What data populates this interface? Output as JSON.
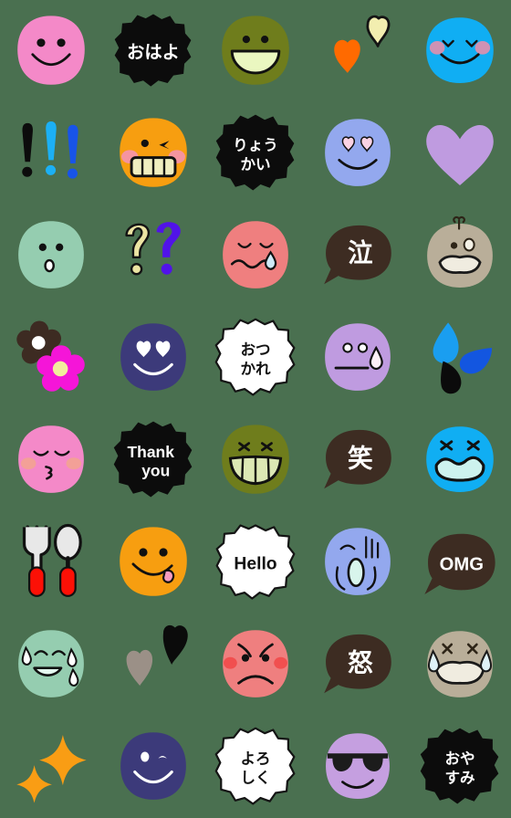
{
  "page": {
    "title": "Emoji Sticker Grid",
    "background_color": "#4a7050",
    "columns": 5,
    "rows": 8,
    "cell_size_px": 112,
    "total_items": 40
  },
  "palette": {
    "background": "#4a7050",
    "pink": "#f489c8",
    "black": "#0c0c0c",
    "olive": "#6f7d1c",
    "orange_heart": "#ff6a00",
    "cream_heart": "#f2eeb0",
    "sky_blue": "#10aef3",
    "mint": "#95cdb0",
    "pale_yellow": "#ece4a3",
    "violet": "#5113e8",
    "salmon": "#ef7f7f",
    "dark_brown": "#3d2c22",
    "taupe": "#b9ae99",
    "flower_brown": "#3d2b22",
    "magenta": "#f515d8",
    "navy": "#3c3a7a",
    "white_cloud": "#ffffff",
    "lavender": "#bf9be0",
    "blue_drop": "#1a9ef0",
    "deep_blue": "#1356e0",
    "orange": "#f79e10",
    "periwinkle": "#93a8ee",
    "red": "#fc1006",
    "silver": "#e3e3e3",
    "amber": "#f99d14",
    "grey_heart": "#9b9087",
    "purple": "#c59fe0",
    "teal_mouth": "#d8f5ec"
  },
  "items": [
    {
      "index": 1,
      "row": 1,
      "col": 1,
      "name": "pink-smiley-face",
      "type": "face",
      "label": "",
      "color": "#f489c8",
      "description": "pink round smiling face with two dots and wide smile"
    },
    {
      "index": 2,
      "row": 1,
      "col": 2,
      "name": "ohayo-text-bubble",
      "type": "text",
      "label": "おはよ",
      "color": "#0c0c0c",
      "text_color": "#ffffff",
      "description": "black fluffy speech blob with Japanese greeting"
    },
    {
      "index": 3,
      "row": 1,
      "col": 3,
      "name": "olive-open-mouth-smile",
      "type": "face",
      "label": "",
      "color": "#6f7d1c",
      "description": "olive green face with big open smile"
    },
    {
      "index": 4,
      "row": 1,
      "col": 4,
      "name": "orange-cream-hearts",
      "type": "object",
      "label": "",
      "color": "#ff6a00",
      "description": "orange heart and cream heart pair"
    },
    {
      "index": 5,
      "row": 1,
      "col": 5,
      "name": "blue-blushing-smile",
      "type": "face",
      "label": "",
      "color": "#10aef3",
      "description": "bright blue face, closed happy eyes, pink cheeks"
    },
    {
      "index": 6,
      "row": 2,
      "col": 1,
      "name": "three-exclamation-marks",
      "type": "object",
      "label": "!!!",
      "color": "#0c0c0c",
      "description": "black, light blue and blue exclamation marks"
    },
    {
      "index": 7,
      "row": 2,
      "col": 2,
      "name": "orange-grin-wink-face",
      "type": "face",
      "label": "",
      "color": "#f79e10",
      "description": "orange face with big teeth grin and wink"
    },
    {
      "index": 8,
      "row": 2,
      "col": 3,
      "name": "ryoukai-text-bubble",
      "type": "text",
      "label": "りょうかい",
      "color": "#0c0c0c",
      "text_color": "#ffffff",
      "lines": [
        "りょう",
        "かい"
      ],
      "description": "black fluffy blob with 'understood'"
    },
    {
      "index": 9,
      "row": 2,
      "col": 4,
      "name": "periwinkle-heart-eyes",
      "type": "face",
      "label": "",
      "color": "#93a8ee",
      "description": "periwinkle face with pink heart eyes and smile"
    },
    {
      "index": 10,
      "row": 2,
      "col": 5,
      "name": "purple-heart",
      "type": "object",
      "label": "",
      "color": "#bf9be0",
      "description": "plain light purple heart"
    },
    {
      "index": 11,
      "row": 3,
      "col": 1,
      "name": "mint-surprised-face",
      "type": "face",
      "label": "",
      "color": "#95cdb0",
      "description": "mint green face with small round open mouth"
    },
    {
      "index": 12,
      "row": 3,
      "col": 2,
      "name": "double-question-marks",
      "type": "object",
      "label": "??",
      "color": "#ece4a3",
      "description": "cream outlined question mark and violet question mark"
    },
    {
      "index": 13,
      "row": 3,
      "col": 3,
      "name": "salmon-crying-face",
      "type": "face",
      "label": "",
      "color": "#ef7f7f",
      "description": "salmon face, closed eyes, wavy mouth, teardrop"
    },
    {
      "index": 14,
      "row": 3,
      "col": 4,
      "name": "naku-text-bubble",
      "type": "text",
      "label": "泣",
      "color": "#3d2c22",
      "text_color": "#ffffff",
      "description": "dark brown speech bubble with kanji for cry"
    },
    {
      "index": 15,
      "row": 3,
      "col": 5,
      "name": "taupe-shocked-face",
      "type": "face",
      "label": "",
      "color": "#b9ae99",
      "description": "taupe face with sweat drop and wide open mouth"
    },
    {
      "index": 16,
      "row": 4,
      "col": 1,
      "name": "two-flowers",
      "type": "object",
      "label": "",
      "color": "#f515d8",
      "description": "dark brown flower and magenta flower"
    },
    {
      "index": 17,
      "row": 4,
      "col": 2,
      "name": "navy-heart-eyes-smile",
      "type": "face",
      "label": "",
      "color": "#3c3a7a",
      "description": "navy face with white heart eyes and smile"
    },
    {
      "index": 18,
      "row": 4,
      "col": 3,
      "name": "otsukare-text-bubble",
      "type": "text",
      "label": "おつかれ",
      "color": "#ffffff",
      "text_color": "#111111",
      "lines": [
        "おつ",
        "かれ"
      ],
      "description": "white cloud blob with 'good work'"
    },
    {
      "index": 19,
      "row": 4,
      "col": 4,
      "name": "lavender-sweat-face",
      "type": "face",
      "label": "",
      "color": "#bf9be0",
      "description": "lavender face, flat mouth, sweat drop"
    },
    {
      "index": 20,
      "row": 4,
      "col": 5,
      "name": "water-droplets",
      "type": "object",
      "label": "",
      "color": "#1a9ef0",
      "description": "three droplets light blue, blue and black"
    },
    {
      "index": 21,
      "row": 5,
      "col": 1,
      "name": "pink-kiss-face",
      "type": "face",
      "label": "",
      "color": "#f489c8",
      "description": "pink face, closed eyes, blush, puckered mouth"
    },
    {
      "index": 22,
      "row": 5,
      "col": 2,
      "name": "thank-you-text-bubble",
      "type": "text",
      "label": "Thank you",
      "color": "#0c0c0c",
      "text_color": "#ffffff",
      "lines": [
        "Thank",
        "you"
      ],
      "description": "black fluffy blob with Thank you"
    },
    {
      "index": 23,
      "row": 5,
      "col": 3,
      "name": "olive-teeth-grin-face",
      "type": "face",
      "label": "",
      "color": "#6f7d1c",
      "description": "olive face with squeezed eyes and toothy grin"
    },
    {
      "index": 24,
      "row": 5,
      "col": 4,
      "name": "warau-text-bubble",
      "type": "text",
      "label": "笑",
      "color": "#3d2c22",
      "text_color": "#ffffff",
      "description": "dark brown bubble with kanji for laugh"
    },
    {
      "index": 25,
      "row": 5,
      "col": 5,
      "name": "blue-distressed-face",
      "type": "face",
      "label": "",
      "color": "#10aef3",
      "description": "blue face with x eyes and open wavy mouth"
    },
    {
      "index": 26,
      "row": 6,
      "col": 1,
      "name": "fork-and-spoon",
      "type": "object",
      "label": "",
      "color": "#fc1006",
      "description": "fork and spoon with red handles"
    },
    {
      "index": 27,
      "row": 6,
      "col": 2,
      "name": "orange-tongue-smiley",
      "type": "face",
      "label": "",
      "color": "#f79e10",
      "description": "orange smiley with tongue sticking out"
    },
    {
      "index": 28,
      "row": 6,
      "col": 3,
      "name": "hello-text-bubble",
      "type": "text",
      "label": "Hello",
      "color": "#ffffff",
      "text_color": "#111111",
      "description": "white cloud blob with Hello"
    },
    {
      "index": 29,
      "row": 6,
      "col": 4,
      "name": "periwinkle-shock-face",
      "type": "face",
      "label": "",
      "color": "#93a8ee",
      "description": "periwinkle face screaming with motion lines"
    },
    {
      "index": 30,
      "row": 6,
      "col": 5,
      "name": "omg-text-bubble",
      "type": "text",
      "label": "OMG",
      "color": "#3d2c22",
      "text_color": "#ffffff",
      "description": "dark brown bubble with OMG"
    },
    {
      "index": 31,
      "row": 7,
      "col": 1,
      "name": "mint-nervous-smile-face",
      "type": "face",
      "label": "",
      "color": "#95cdb0",
      "description": "mint face, smile and sweat drops"
    },
    {
      "index": 32,
      "row": 7,
      "col": 2,
      "name": "black-grey-hearts",
      "type": "object",
      "label": "",
      "color": "#0c0c0c",
      "description": "black heart and grey heart pair"
    },
    {
      "index": 33,
      "row": 7,
      "col": 3,
      "name": "salmon-angry-face",
      "type": "face",
      "label": "",
      "color": "#ef7f7f",
      "description": "salmon angry face with frown and red blush"
    },
    {
      "index": 34,
      "row": 7,
      "col": 4,
      "name": "ikari-text-bubble",
      "type": "text",
      "label": "怒",
      "color": "#3d2c22",
      "text_color": "#ffffff",
      "description": "dark brown bubble with kanji for anger"
    },
    {
      "index": 35,
      "row": 7,
      "col": 5,
      "name": "taupe-sobbing-face",
      "type": "face",
      "label": "",
      "color": "#b9ae99",
      "description": "taupe face crying with tears both sides"
    },
    {
      "index": 36,
      "row": 8,
      "col": 1,
      "name": "sparkles",
      "type": "object",
      "label": "",
      "color": "#f99d14",
      "description": "two orange four point sparkle stars"
    },
    {
      "index": 37,
      "row": 8,
      "col": 2,
      "name": "navy-wink-smile-face",
      "type": "face",
      "label": "",
      "color": "#3c3a7a",
      "description": "navy face with wink and white smile"
    },
    {
      "index": 38,
      "row": 8,
      "col": 3,
      "name": "yoroshiku-text-bubble",
      "type": "text",
      "label": "よろしく",
      "color": "#ffffff",
      "text_color": "#111111",
      "lines": [
        "よろ",
        "しく"
      ],
      "description": "white cloud blob with 'nice to meet you'"
    },
    {
      "index": 39,
      "row": 8,
      "col": 4,
      "name": "purple-sunglasses-face",
      "type": "face",
      "label": "",
      "color": "#c59fe0",
      "description": "purple face with black sunglasses and smirk"
    },
    {
      "index": 40,
      "row": 8,
      "col": 5,
      "name": "oyasumi-text-bubble",
      "type": "text",
      "label": "おやすみ",
      "color": "#0c0c0c",
      "text_color": "#ffffff",
      "lines": [
        "おや",
        "すみ"
      ],
      "description": "black fluffy blob with 'good night'"
    }
  ]
}
